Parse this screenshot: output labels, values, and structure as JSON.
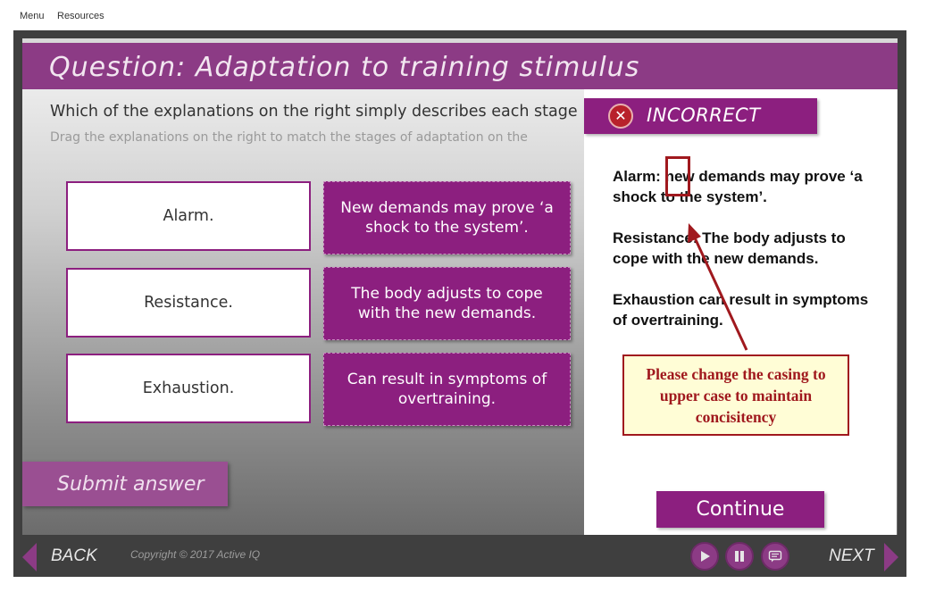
{
  "top_menu": {
    "menu_label": "Menu",
    "resources_label": "Resources"
  },
  "slide": {
    "title": "Question: Adaptation to training stimulus",
    "question": "Which of the explanations on the right simply describes each stage",
    "instruction": "Drag the explanations on the right to match the stages of adaptation on the",
    "stages": [
      "Alarm.",
      "Resistance.",
      "Exhaustion."
    ],
    "explanations": [
      "New demands may prove ‘a shock to the system’.",
      "The body adjusts to cope with the new demands.",
      "Can result in symptoms of overtraining."
    ],
    "submit_label": "Submit answer"
  },
  "feedback": {
    "status": "INCORRECT",
    "lines": [
      "Alarm: new demands may prove ‘a shock to the system’.",
      "Resistance: The body adjusts to cope with the new demands.",
      "Exhaustion can result in symptoms of overtraining."
    ],
    "continue_label": "Continue"
  },
  "annotation": {
    "note": "Please change the casing to upper case to maintain concisitency",
    "color": "#a0191e"
  },
  "player": {
    "back_label": "BACK",
    "next_label": "NEXT",
    "copyright": "Copyright © 2017 Active IQ",
    "controls": [
      "play-icon",
      "pause-icon",
      "captions-icon"
    ]
  },
  "colors": {
    "brand": "#8c1f7f",
    "title_bar": "#8c3b85",
    "player_bg": "#3f3f3f"
  }
}
